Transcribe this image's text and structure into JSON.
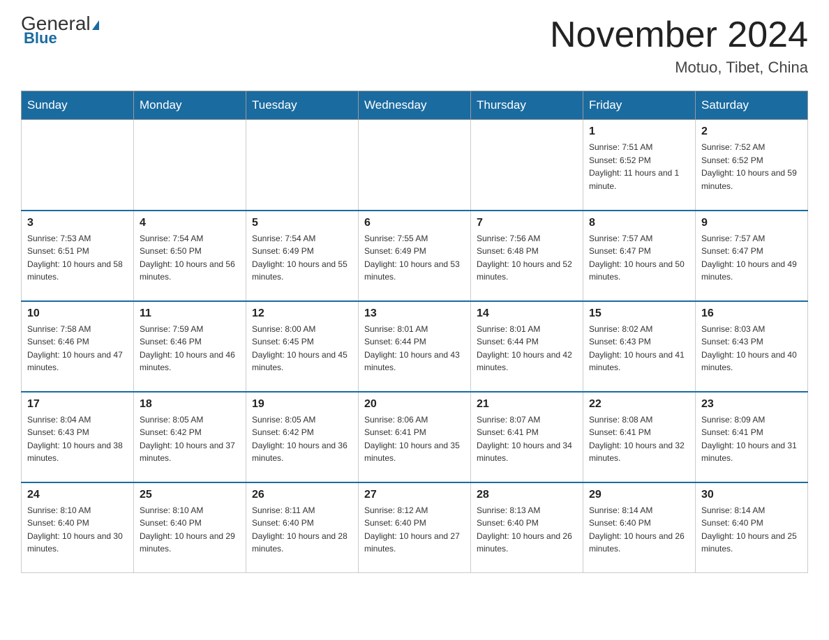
{
  "header": {
    "logo_general": "General",
    "logo_blue": "Blue",
    "month_title": "November 2024",
    "location": "Motuo, Tibet, China"
  },
  "weekdays": [
    "Sunday",
    "Monday",
    "Tuesday",
    "Wednesday",
    "Thursday",
    "Friday",
    "Saturday"
  ],
  "weeks": [
    [
      {
        "day": "",
        "sunrise": "",
        "sunset": "",
        "daylight": ""
      },
      {
        "day": "",
        "sunrise": "",
        "sunset": "",
        "daylight": ""
      },
      {
        "day": "",
        "sunrise": "",
        "sunset": "",
        "daylight": ""
      },
      {
        "day": "",
        "sunrise": "",
        "sunset": "",
        "daylight": ""
      },
      {
        "day": "",
        "sunrise": "",
        "sunset": "",
        "daylight": ""
      },
      {
        "day": "1",
        "sunrise": "Sunrise: 7:51 AM",
        "sunset": "Sunset: 6:52 PM",
        "daylight": "Daylight: 11 hours and 1 minute."
      },
      {
        "day": "2",
        "sunrise": "Sunrise: 7:52 AM",
        "sunset": "Sunset: 6:52 PM",
        "daylight": "Daylight: 10 hours and 59 minutes."
      }
    ],
    [
      {
        "day": "3",
        "sunrise": "Sunrise: 7:53 AM",
        "sunset": "Sunset: 6:51 PM",
        "daylight": "Daylight: 10 hours and 58 minutes."
      },
      {
        "day": "4",
        "sunrise": "Sunrise: 7:54 AM",
        "sunset": "Sunset: 6:50 PM",
        "daylight": "Daylight: 10 hours and 56 minutes."
      },
      {
        "day": "5",
        "sunrise": "Sunrise: 7:54 AM",
        "sunset": "Sunset: 6:49 PM",
        "daylight": "Daylight: 10 hours and 55 minutes."
      },
      {
        "day": "6",
        "sunrise": "Sunrise: 7:55 AM",
        "sunset": "Sunset: 6:49 PM",
        "daylight": "Daylight: 10 hours and 53 minutes."
      },
      {
        "day": "7",
        "sunrise": "Sunrise: 7:56 AM",
        "sunset": "Sunset: 6:48 PM",
        "daylight": "Daylight: 10 hours and 52 minutes."
      },
      {
        "day": "8",
        "sunrise": "Sunrise: 7:57 AM",
        "sunset": "Sunset: 6:47 PM",
        "daylight": "Daylight: 10 hours and 50 minutes."
      },
      {
        "day": "9",
        "sunrise": "Sunrise: 7:57 AM",
        "sunset": "Sunset: 6:47 PM",
        "daylight": "Daylight: 10 hours and 49 minutes."
      }
    ],
    [
      {
        "day": "10",
        "sunrise": "Sunrise: 7:58 AM",
        "sunset": "Sunset: 6:46 PM",
        "daylight": "Daylight: 10 hours and 47 minutes."
      },
      {
        "day": "11",
        "sunrise": "Sunrise: 7:59 AM",
        "sunset": "Sunset: 6:46 PM",
        "daylight": "Daylight: 10 hours and 46 minutes."
      },
      {
        "day": "12",
        "sunrise": "Sunrise: 8:00 AM",
        "sunset": "Sunset: 6:45 PM",
        "daylight": "Daylight: 10 hours and 45 minutes."
      },
      {
        "day": "13",
        "sunrise": "Sunrise: 8:01 AM",
        "sunset": "Sunset: 6:44 PM",
        "daylight": "Daylight: 10 hours and 43 minutes."
      },
      {
        "day": "14",
        "sunrise": "Sunrise: 8:01 AM",
        "sunset": "Sunset: 6:44 PM",
        "daylight": "Daylight: 10 hours and 42 minutes."
      },
      {
        "day": "15",
        "sunrise": "Sunrise: 8:02 AM",
        "sunset": "Sunset: 6:43 PM",
        "daylight": "Daylight: 10 hours and 41 minutes."
      },
      {
        "day": "16",
        "sunrise": "Sunrise: 8:03 AM",
        "sunset": "Sunset: 6:43 PM",
        "daylight": "Daylight: 10 hours and 40 minutes."
      }
    ],
    [
      {
        "day": "17",
        "sunrise": "Sunrise: 8:04 AM",
        "sunset": "Sunset: 6:43 PM",
        "daylight": "Daylight: 10 hours and 38 minutes."
      },
      {
        "day": "18",
        "sunrise": "Sunrise: 8:05 AM",
        "sunset": "Sunset: 6:42 PM",
        "daylight": "Daylight: 10 hours and 37 minutes."
      },
      {
        "day": "19",
        "sunrise": "Sunrise: 8:05 AM",
        "sunset": "Sunset: 6:42 PM",
        "daylight": "Daylight: 10 hours and 36 minutes."
      },
      {
        "day": "20",
        "sunrise": "Sunrise: 8:06 AM",
        "sunset": "Sunset: 6:41 PM",
        "daylight": "Daylight: 10 hours and 35 minutes."
      },
      {
        "day": "21",
        "sunrise": "Sunrise: 8:07 AM",
        "sunset": "Sunset: 6:41 PM",
        "daylight": "Daylight: 10 hours and 34 minutes."
      },
      {
        "day": "22",
        "sunrise": "Sunrise: 8:08 AM",
        "sunset": "Sunset: 6:41 PM",
        "daylight": "Daylight: 10 hours and 32 minutes."
      },
      {
        "day": "23",
        "sunrise": "Sunrise: 8:09 AM",
        "sunset": "Sunset: 6:41 PM",
        "daylight": "Daylight: 10 hours and 31 minutes."
      }
    ],
    [
      {
        "day": "24",
        "sunrise": "Sunrise: 8:10 AM",
        "sunset": "Sunset: 6:40 PM",
        "daylight": "Daylight: 10 hours and 30 minutes."
      },
      {
        "day": "25",
        "sunrise": "Sunrise: 8:10 AM",
        "sunset": "Sunset: 6:40 PM",
        "daylight": "Daylight: 10 hours and 29 minutes."
      },
      {
        "day": "26",
        "sunrise": "Sunrise: 8:11 AM",
        "sunset": "Sunset: 6:40 PM",
        "daylight": "Daylight: 10 hours and 28 minutes."
      },
      {
        "day": "27",
        "sunrise": "Sunrise: 8:12 AM",
        "sunset": "Sunset: 6:40 PM",
        "daylight": "Daylight: 10 hours and 27 minutes."
      },
      {
        "day": "28",
        "sunrise": "Sunrise: 8:13 AM",
        "sunset": "Sunset: 6:40 PM",
        "daylight": "Daylight: 10 hours and 26 minutes."
      },
      {
        "day": "29",
        "sunrise": "Sunrise: 8:14 AM",
        "sunset": "Sunset: 6:40 PM",
        "daylight": "Daylight: 10 hours and 26 minutes."
      },
      {
        "day": "30",
        "sunrise": "Sunrise: 8:14 AM",
        "sunset": "Sunset: 6:40 PM",
        "daylight": "Daylight: 10 hours and 25 minutes."
      }
    ]
  ]
}
